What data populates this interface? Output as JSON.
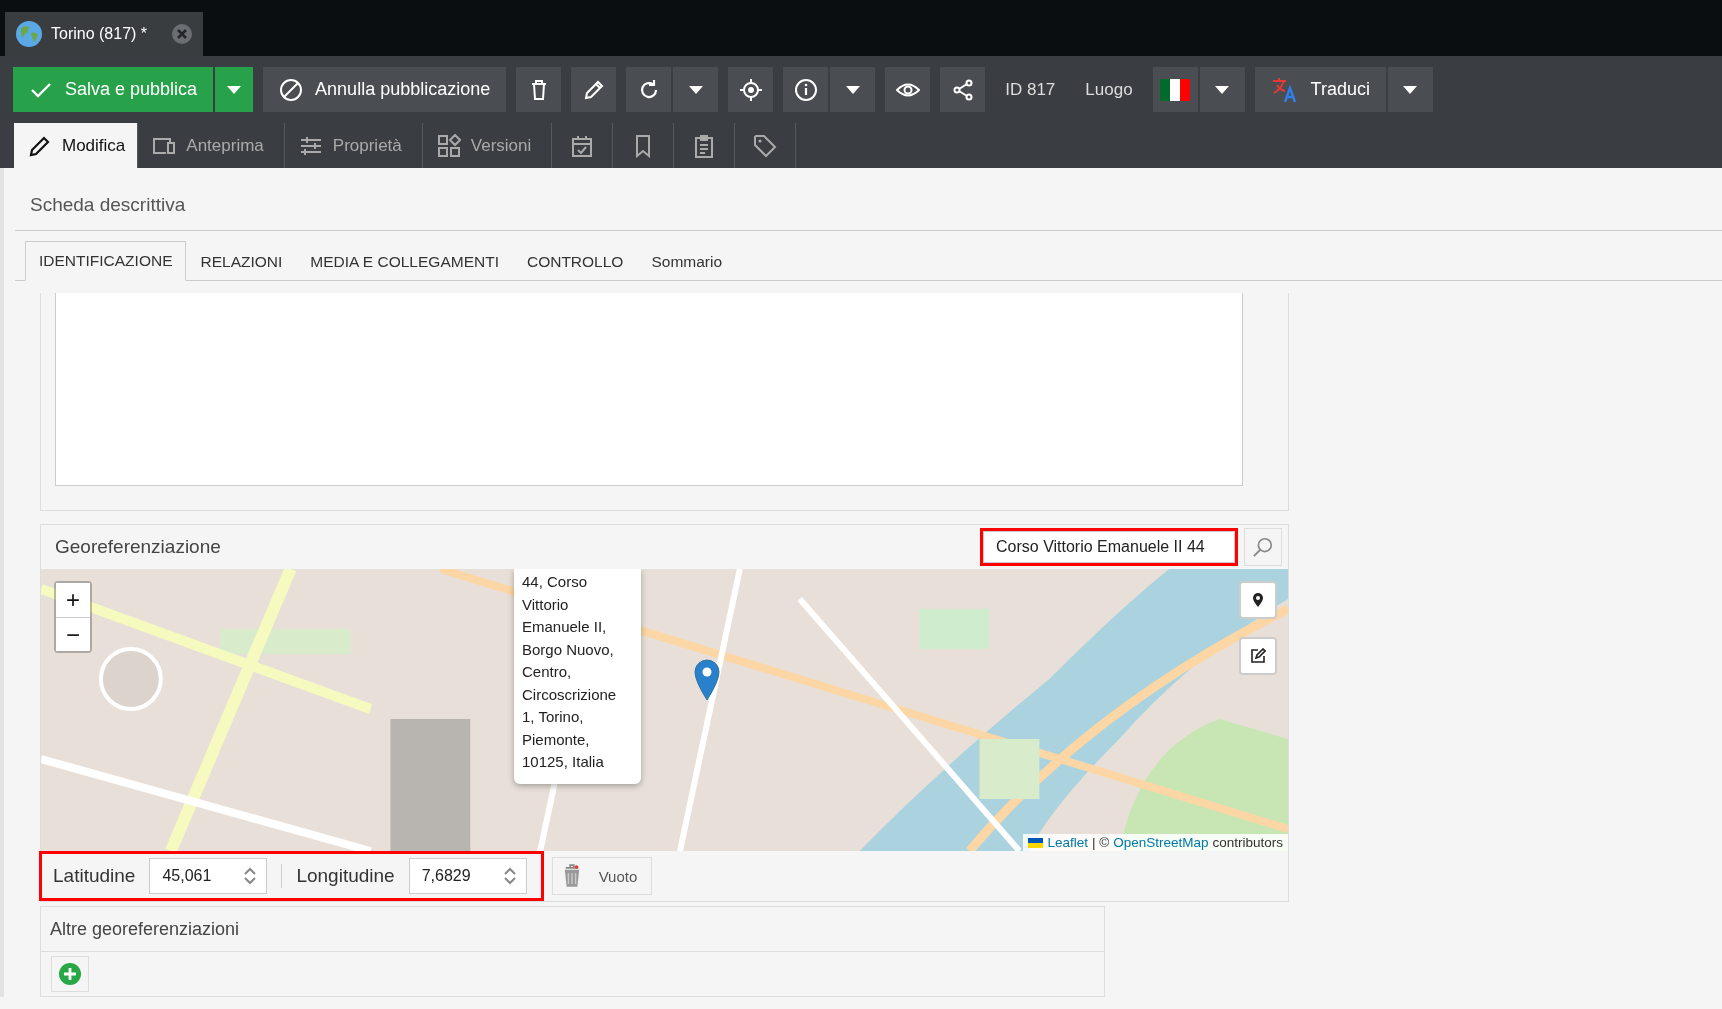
{
  "document_tab": {
    "title": "Torino (817) *"
  },
  "toolbar": {
    "publish": "Salva e pubblica",
    "unpublish": "Annulla pubblicazione",
    "id": "ID 817",
    "type": "Luogo",
    "translate": "Traduci"
  },
  "view_tabs": [
    {
      "label": "Modifica",
      "selected": true
    },
    {
      "label": "Anteprima",
      "selected": false
    },
    {
      "label": "Proprietà",
      "selected": false
    },
    {
      "label": "Versioni",
      "selected": false
    }
  ],
  "section_title": "Scheda descrittiva",
  "form_tabs": [
    {
      "label": "IDENTIFICAZIONE",
      "selected": true
    },
    {
      "label": "RELAZIONI",
      "selected": false
    },
    {
      "label": "MEDIA E COLLEGAMENTI",
      "selected": false
    },
    {
      "label": "CONTROLLO",
      "selected": false
    },
    {
      "label": "Sommario",
      "selected": false
    }
  ],
  "georef": {
    "title": "Georeferenziazione",
    "search_value": "Corso Vittorio Emanuele II 44",
    "zoom_in": "+",
    "zoom_out": "−",
    "popup": "44, Corso Vittorio Emanuele II, Borgo Nuovo, Centro, Circoscrizione 1, Torino, Piemonte, 10125, Italia",
    "attribution": {
      "link1": "Leaflet",
      "separator": "| ©",
      "link2": "OpenStreetMap",
      "suffix": "contributors"
    },
    "lat_label": "Latitudine",
    "lat_value": "45,061",
    "lon_label": "Longitudine",
    "lon_value": "7,6829",
    "clear": "Vuoto"
  },
  "other": {
    "title": "Altre georeferenziazioni"
  }
}
